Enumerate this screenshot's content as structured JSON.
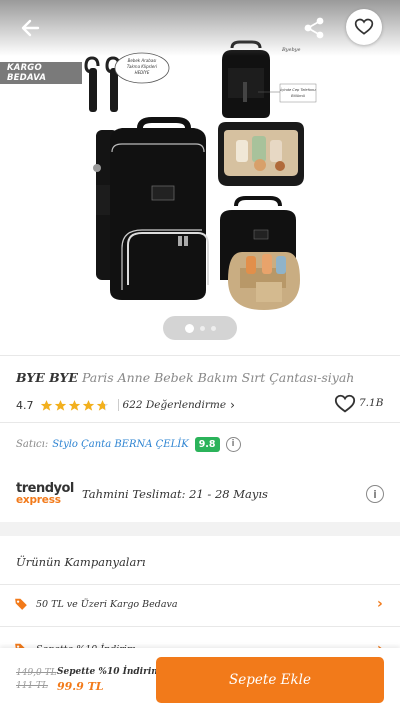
{
  "gallery": {
    "badge": "KARGO BEDAVA",
    "image_labels": {
      "hooks_bubble": "Bebek Arabası Takma Klipsleri HEDİYE",
      "brand_mark": "Byebye",
      "side_label": "İçinde Cep Telefonu Bölümü"
    },
    "pager": {
      "total": 3,
      "active": 1
    }
  },
  "product": {
    "brand": "BYE BYE",
    "name": "Paris Anne Bebek Bakım Sırt Çantası-siyah",
    "rating": "4.7",
    "stars": 4.7,
    "reviews": "622 Değerlendirme",
    "favorites": "7.1B"
  },
  "seller": {
    "label": "Satıcı:",
    "name": "Stylo Çanta BERNA ÇELİK",
    "score": "9.8"
  },
  "delivery": {
    "logo_top": "trendyol",
    "logo_bottom": "express",
    "text": "Tahmini Teslimat: 21 - 28 Mayıs"
  },
  "campaigns": {
    "title": "Ürünün Kampanyaları",
    "items": [
      {
        "label": "50 TL ve Üzeri Kargo Bedava"
      },
      {
        "label": "Sepette %10 İndirim"
      }
    ]
  },
  "bottom": {
    "price_old": "149,0 TL",
    "price_mid": "111 TL",
    "promo": "Sepette %10 İndirim",
    "price_new": "99.9 TL",
    "cta": "Sepete Ekle"
  },
  "colors": {
    "accent": "#f27a1a",
    "seller_link": "#2e84d2",
    "score_badge": "#2bb35a",
    "star": "#f2b01e"
  }
}
